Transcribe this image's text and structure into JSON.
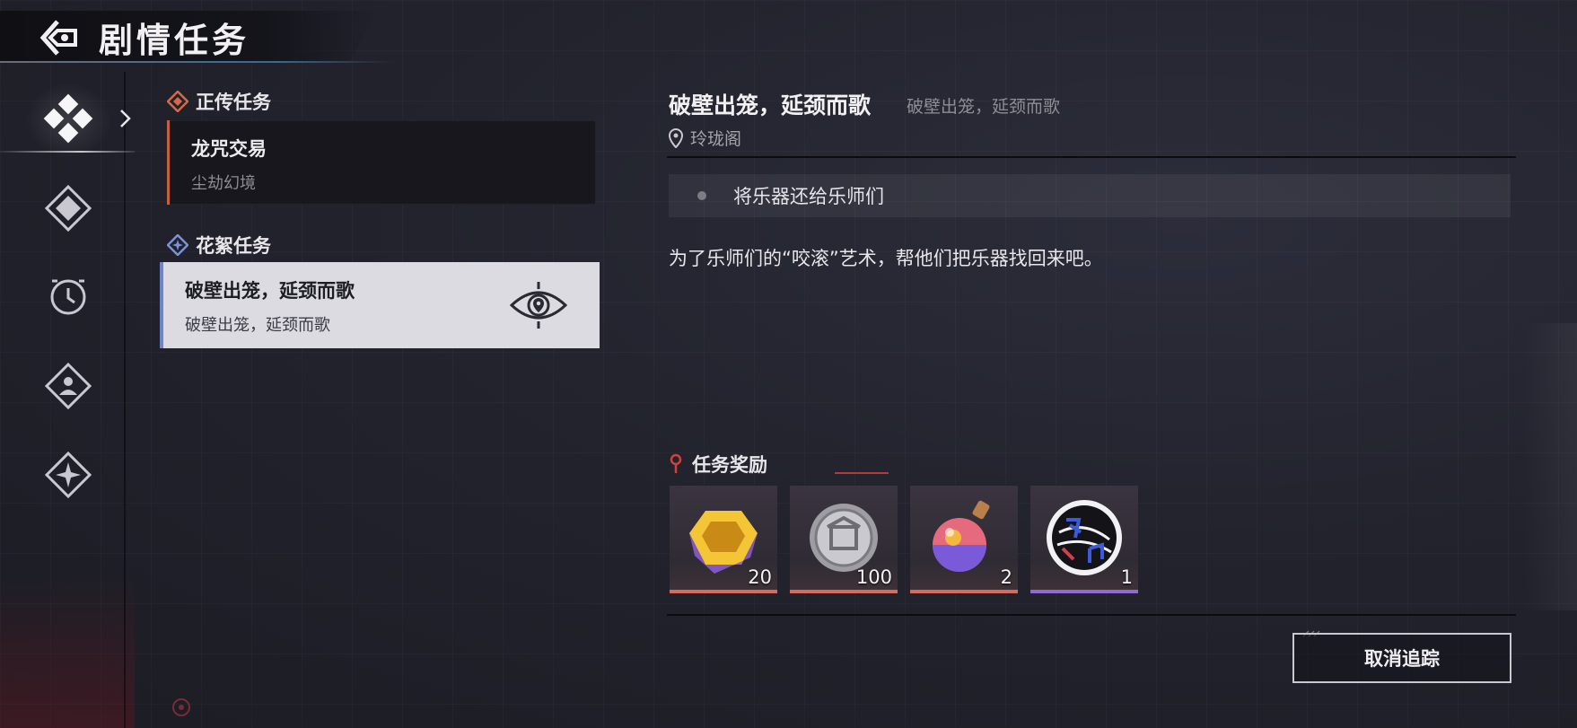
{
  "header": {
    "title": "剧情任务"
  },
  "nav": {
    "items": [
      "story-tab",
      "quest-tab-2",
      "time-quest-tab",
      "character-quest-tab",
      "star-quest-tab"
    ]
  },
  "quest_list": {
    "main_section": {
      "label": "正传任务",
      "accent": "#c3603f"
    },
    "main_quests": [
      {
        "name": "龙咒交易",
        "location": "尘劫幻境"
      }
    ],
    "side_section": {
      "label": "花絮任务",
      "accent": "#6e86c9"
    },
    "side_quests": [
      {
        "name": "破壁出笼，延颈而歌",
        "subtitle": "破壁出笼，延颈而歌",
        "selected": true,
        "tracked": true
      }
    ]
  },
  "detail": {
    "title": "破壁出笼，延颈而歌",
    "subtitle": "破壁出笼，延颈而歌",
    "location": "玲珑阁",
    "objective": "将乐器还给乐师们",
    "description": "为了乐师们的“咬滚”艺术，帮他们把乐器找回来吧。",
    "rewards_label": "任务奖励",
    "rewards": [
      {
        "icon": "gem-icon",
        "qty": "20",
        "rarity_color": "#d56a5f"
      },
      {
        "icon": "silver-coin-icon",
        "qty": "100",
        "rarity_color": "#d56a5f"
      },
      {
        "icon": "potion-icon",
        "qty": "2",
        "rarity_color": "#d56a5f"
      },
      {
        "icon": "music-record-icon",
        "qty": "1",
        "rarity_color": "#8f6ad6"
      }
    ],
    "cancel_button": "取消追踪"
  }
}
